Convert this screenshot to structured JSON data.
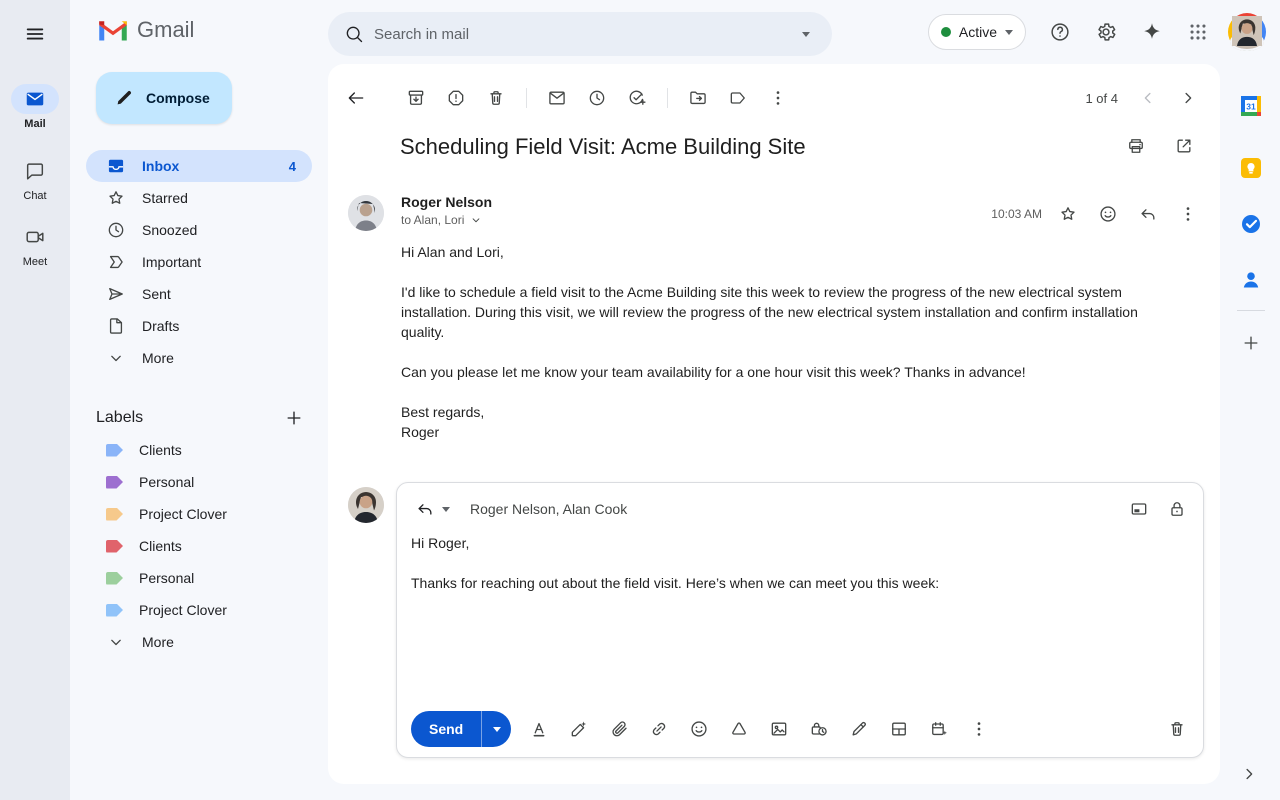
{
  "colors": {
    "accent_blue": "#0b57d0",
    "compose_bg": "#c2e7ff",
    "selected_pill_bg": "#d3e3fd",
    "send_button_bg": "#0b57d0",
    "active_status_dot": "#1e8e3e",
    "background": "#f6f8fc",
    "card_bg": "#ffffff"
  },
  "topbar": {
    "app_name": "Gmail",
    "search_placeholder": "Search in mail",
    "status_label": "Active"
  },
  "left_rail": {
    "mail_label": "Mail",
    "chat_label": "Chat",
    "meet_label": "Meet"
  },
  "sidebar": {
    "compose_label": "Compose",
    "nav": [
      {
        "label": "Inbox",
        "count": "4",
        "active": true
      },
      {
        "label": "Starred"
      },
      {
        "label": "Snoozed"
      },
      {
        "label": "Important"
      },
      {
        "label": "Sent"
      },
      {
        "label": "Drafts"
      },
      {
        "label": "More"
      }
    ],
    "labels_heading": "Labels",
    "labels": [
      {
        "name": "Clients",
        "color": "#8ab4f8"
      },
      {
        "name": "Personal",
        "color": "#9d6fd0"
      },
      {
        "name": "Project Clover",
        "color": "#f6c98b"
      },
      {
        "name": "Clients",
        "color": "#e0636b"
      },
      {
        "name": "Personal",
        "color": "#9ccf9d"
      },
      {
        "name": "Project Clover",
        "color": "#90c3f9"
      }
    ],
    "labels_more": "More"
  },
  "thread": {
    "pagination": "1 of 4",
    "subject": "Scheduling Field Visit: Acme Building Site",
    "message": {
      "sender": "Roger Nelson",
      "recipients_line": "to Alan, Lori",
      "time": "10:03 AM",
      "paragraph1": "Hi Alan and Lori,",
      "paragraph2": "I'd like to schedule a field visit to the Acme Building site this week to review the progress of the new electrical system installation. During this visit, we will review the progress of the new electrical system installation and confirm installation quality.",
      "paragraph3": "Can you please let me know your team availability for a one hour visit this week? Thanks in advance!",
      "signoff": "Best regards,",
      "signature": "Roger"
    },
    "reply": {
      "recipients": "Roger Nelson, Alan Cook",
      "paragraph1": "Hi Roger,",
      "paragraph2": "Thanks for reaching out about the field visit. Here’s when we can meet you this week:",
      "send_label": "Send"
    }
  },
  "icons": {
    "topbar": [
      "hamburger-menu",
      "gmail-logo",
      "search",
      "search-options-caret",
      "status-dot",
      "status-caret",
      "help",
      "settings-gear",
      "gemini-sparkle",
      "apps-grid",
      "profile-avatar"
    ],
    "left_rail": [
      "mail-envelope",
      "chat-bubble",
      "meet-camera"
    ],
    "thread_toolbar": [
      "back-arrow",
      "archive",
      "report-spam",
      "delete",
      "mark-unread",
      "snooze",
      "add-to-tasks",
      "move-to-folder",
      "labels-tag",
      "more-vertical",
      "chevron-left",
      "chevron-right"
    ],
    "subject_actions": [
      "print",
      "open-in-new"
    ],
    "message_actions": [
      "star",
      "emoji-reaction",
      "reply",
      "more-vertical"
    ],
    "reply_header": [
      "reply-arrow",
      "reply-type-caret",
      "pop-out",
      "lock"
    ],
    "compose_toolbar": [
      "formatting",
      "help-me-write",
      "attach-file",
      "insert-link",
      "insert-emoji",
      "drive",
      "insert-photo",
      "confidential-mode",
      "signature-pen",
      "layouts",
      "schedule-meeting",
      "more-vertical",
      "discard-draft"
    ],
    "right_rail": [
      "calendar",
      "keep",
      "tasks",
      "contacts",
      "get-addons-plus",
      "show-side-panel-chevron"
    ]
  }
}
